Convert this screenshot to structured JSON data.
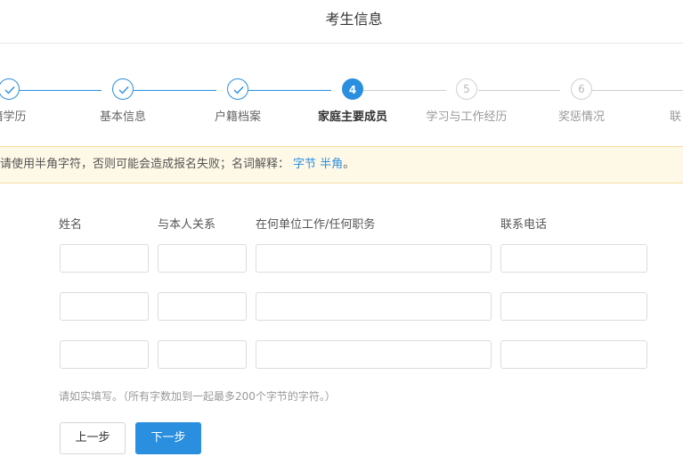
{
  "header": {
    "title": "考生信息"
  },
  "steps": [
    {
      "label": "籍学历",
      "number": "",
      "state": "done"
    },
    {
      "label": "基本信息",
      "number": "",
      "state": "done"
    },
    {
      "label": "户籍档案",
      "number": "",
      "state": "done"
    },
    {
      "label": "家庭主要成员",
      "number": "4",
      "state": "active"
    },
    {
      "label": "学习与工作经历",
      "number": "5",
      "state": "todo"
    },
    {
      "label": "奖惩情况",
      "number": "6",
      "state": "todo"
    },
    {
      "label": "联",
      "number": "",
      "state": "todo"
    }
  ],
  "notice": {
    "text": "请使用半角字符，否则可能会造成报名失败；名词解释：",
    "link1": "字节",
    "link2": "半角",
    "end": "。"
  },
  "form": {
    "columns": [
      "姓名",
      "与本人关系",
      "在何单位工作/任何职务",
      "联系电话"
    ],
    "rows": [
      {
        "name": "",
        "relation": "",
        "work": "",
        "phone": ""
      },
      {
        "name": "",
        "relation": "",
        "work": "",
        "phone": ""
      },
      {
        "name": "",
        "relation": "",
        "work": "",
        "phone": ""
      }
    ],
    "hint": "请如实填写。（所有字数加到一起最多200个字节的字符。）"
  },
  "buttons": {
    "prev": "上一步",
    "next": "下一步"
  },
  "colors": {
    "accent": "#2b8fe0",
    "notice_bg": "#fef8e7",
    "notice_border": "#f3dea0"
  },
  "icons": {
    "done_step": "check-icon"
  }
}
